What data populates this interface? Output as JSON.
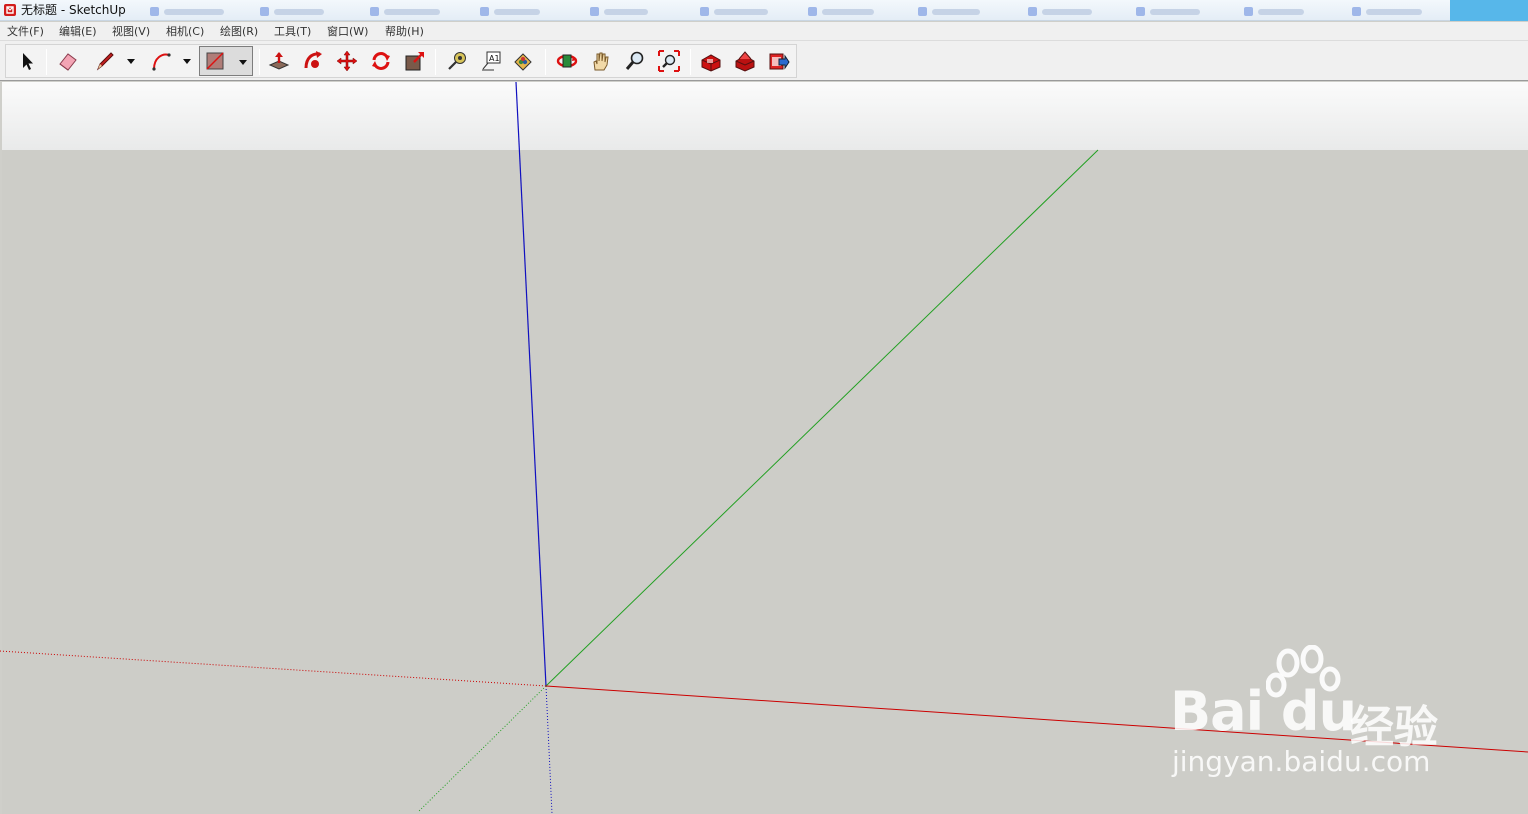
{
  "window": {
    "title": "无标题 - SketchUp"
  },
  "menu": {
    "items": [
      "文件(F)",
      "编辑(E)",
      "视图(V)",
      "相机(C)",
      "绘图(R)",
      "工具(T)",
      "窗口(W)",
      "帮助(H)"
    ]
  },
  "toolbar": {
    "tools": [
      {
        "name": "select",
        "icon": "arrow-cursor-icon"
      },
      {
        "name": "eraser",
        "icon": "eraser-icon"
      },
      {
        "name": "pencil",
        "icon": "pencil-icon"
      },
      {
        "name": "arc",
        "icon": "arc-icon"
      },
      {
        "name": "rectangle",
        "icon": "rectangle-icon",
        "active": true
      },
      {
        "name": "push-pull",
        "icon": "push-pull-icon"
      },
      {
        "name": "follow-me",
        "icon": "follow-me-icon"
      },
      {
        "name": "move",
        "icon": "move-icon"
      },
      {
        "name": "rotate",
        "icon": "rotate-icon"
      },
      {
        "name": "scale",
        "icon": "scale-icon"
      },
      {
        "name": "tape-measure",
        "icon": "tape-measure-icon"
      },
      {
        "name": "text",
        "icon": "text-icon"
      },
      {
        "name": "paint-bucket",
        "icon": "paint-bucket-icon"
      },
      {
        "name": "orbit",
        "icon": "orbit-icon"
      },
      {
        "name": "pan",
        "icon": "hand-icon"
      },
      {
        "name": "zoom",
        "icon": "magnifier-icon"
      },
      {
        "name": "zoom-extents",
        "icon": "zoom-extents-icon"
      },
      {
        "name": "3d-warehouse",
        "icon": "warehouse-icon"
      },
      {
        "name": "extension-warehouse",
        "icon": "extension-warehouse-icon"
      },
      {
        "name": "share-model",
        "icon": "share-model-icon"
      }
    ],
    "text_tool_label": "A1"
  },
  "viewport": {
    "sky_color": "#f4f4f4",
    "ground_color": "#cdcdc8",
    "axis_colors": {
      "red": "#cc0000",
      "green": "#22a022",
      "blue": "#1010c0"
    }
  },
  "watermark": {
    "logo": "Bai du",
    "cn": "经验",
    "url": "jingyan.baidu.com"
  }
}
